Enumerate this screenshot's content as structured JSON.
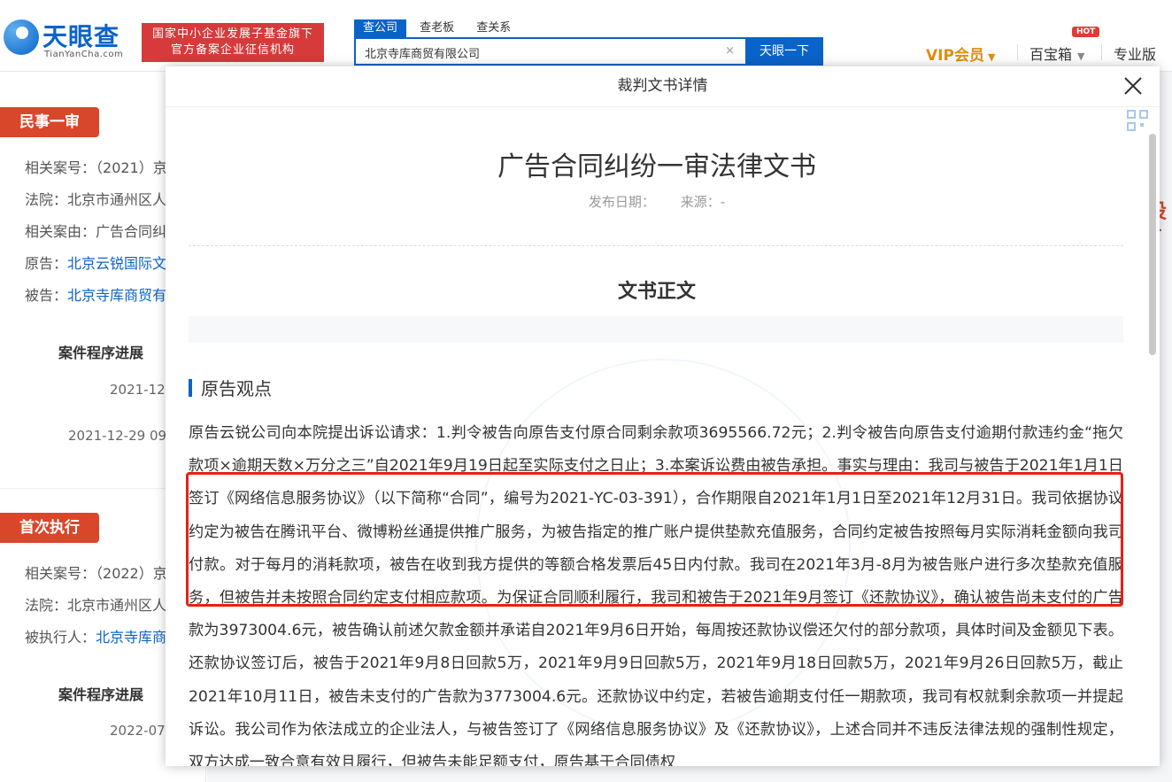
{
  "header": {
    "logo_cn": "天眼查",
    "logo_en": "TianYanCha.com",
    "slogan_line1": "国家中小企业发展子基金旗下",
    "slogan_line2": "官方备案企业征信机构",
    "search_tabs": [
      "查公司",
      "查老板",
      "查关系"
    ],
    "search_value": "北京寺库商贸有限公司",
    "clear_glyph": "×",
    "search_button": "天眼一下",
    "vip_label": "VIP会员",
    "toolbox_label": "百宝箱",
    "hot_badge": "HOT",
    "pro_label": "专业版"
  },
  "background": {
    "section1_tag": "民事一审",
    "case_no_label": "相关案号：",
    "case_no_value": "（2021）京",
    "court_label": "法院：",
    "court_value": "北京市通州区人",
    "cause_label": "相关案由：",
    "cause_value": "广告合同纠",
    "plaintiff_label": "原告：",
    "plaintiff_value": "北京云锐国际文",
    "defendant_label": "被告：",
    "defendant_value": "北京寺库商贸有",
    "progress_title": "案件程序进展",
    "progress_date1": "2021-12",
    "progress_date2": "2021-12-29 09",
    "section2_tag": "首次执行",
    "case_no2_value": "（2022）京",
    "court2_value": "北京市通州区人",
    "executed_label": "被执行人：",
    "executed_value": "北京寺库商贸",
    "progress_title2": "案件程序进展",
    "progress_date3": "2022-07",
    "ad_peek": "设计"
  },
  "modal": {
    "title": "裁判文书详情",
    "doc_title": "广告合同纠纷一审法律文书",
    "publish_label": "发布日期：",
    "source_label": "来源：-",
    "section_title": "文书正文",
    "subsection_title": "原告观点",
    "body_text": "原告云锐公司向本院提出诉讼请求：1.判令被告向原告支付原合同剩余款项3695566.72元；2.判令被告向原告支付逾期付款违约金“拖欠款项×逾期天数×万分之三”自2021年9月19日起至实际支付之日止；3.本案诉讼费由被告承担。事实与理由：我司与被告于2021年1月1日签订《网络信息服务协议》（以下简称“合同”，编号为2021-YC-03-391），合作期限自2021年1月1日至2021年12月31日。我司依据协议约定为被告在腾讯平台、微博粉丝通提供推广服务，为被告指定的推广账户提供垫款充值服务，合同约定被告按照每月实际消耗金额向我司付款。对于每月的消耗款项，被告在收到我方提供的等额合格发票后45日内付款。我司在2021年3月-8月为被告账户进行多次垫款充值服务，但被告并未按照合同约定支付相应款项。为保证合同顺利履行，我司和被告于2021年9月签订《还款协议》，确认被告尚未支付的广告款为3973004.6元，被告确认前述欠款金额并承诺自2021年9月6日开始，每周按还款协议偿还欠付的部分款项，具体时间及金额见下表。还款协议签订后，被告于2021年9月8日回款5万，2021年9月9日回款5万，2021年9月18日回款5万，2021年9月26日回款5万，截止2021年10月11日，被告未支付的广告款为3773004.6元。还款协议中约定，若被告逾期支付任一期款项，我司有权就剩余款项一并提起诉讼。我公司作为依法成立的企业法人，与被告签订了《网络信息服务协议》及《还款协议》，上述合同并不违反法律法规的强制性规定，双方达成一致合意有效且履行，但被告未能足额支付，原告基于合同债权"
  },
  "colors": {
    "brand_blue": "#0a63c9",
    "tag_red": "#d9472b",
    "highlight_red": "#e62117",
    "vip_gold": "#e08f10"
  }
}
